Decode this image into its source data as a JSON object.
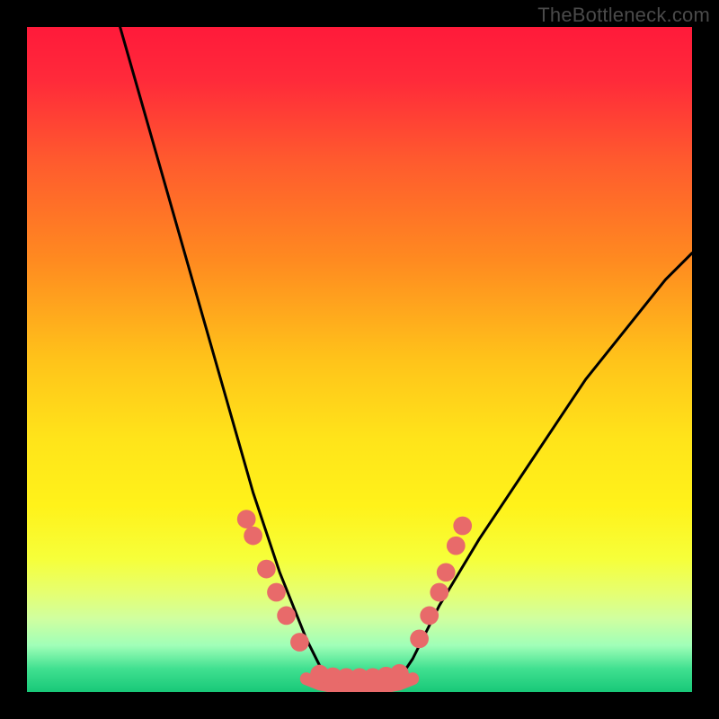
{
  "watermark": "TheBottleneck.com",
  "chart_data": {
    "type": "line",
    "title": "",
    "xlabel": "",
    "ylabel": "",
    "xlim": [
      0,
      100
    ],
    "ylim": [
      0,
      100
    ],
    "grid": false,
    "legend": false,
    "background_gradient_stops": [
      {
        "offset": 0.0,
        "color": "#ff1a3a"
      },
      {
        "offset": 0.08,
        "color": "#ff2a3a"
      },
      {
        "offset": 0.2,
        "color": "#ff5a2e"
      },
      {
        "offset": 0.35,
        "color": "#ff8a20"
      },
      {
        "offset": 0.5,
        "color": "#ffc31a"
      },
      {
        "offset": 0.62,
        "color": "#ffe41a"
      },
      {
        "offset": 0.72,
        "color": "#fff21a"
      },
      {
        "offset": 0.8,
        "color": "#f6ff3a"
      },
      {
        "offset": 0.85,
        "color": "#e6ff70"
      },
      {
        "offset": 0.89,
        "color": "#d0ffa0"
      },
      {
        "offset": 0.93,
        "color": "#a0ffb8"
      },
      {
        "offset": 0.965,
        "color": "#40e090"
      },
      {
        "offset": 1.0,
        "color": "#18c878"
      }
    ],
    "series": [
      {
        "name": "left-curve",
        "stroke": "#000000",
        "x": [
          14,
          16,
          18,
          20,
          22,
          24,
          26,
          28,
          30,
          32,
          34,
          36,
          38,
          40,
          42,
          44,
          45
        ],
        "y": [
          100,
          93,
          86,
          79,
          72,
          65,
          58,
          51,
          44,
          37,
          30,
          24,
          18,
          13,
          8,
          4,
          2
        ]
      },
      {
        "name": "right-curve",
        "stroke": "#000000",
        "x": [
          56,
          58,
          60,
          62,
          65,
          68,
          72,
          76,
          80,
          84,
          88,
          92,
          96,
          100
        ],
        "y": [
          2,
          5,
          9,
          13,
          18,
          23,
          29,
          35,
          41,
          47,
          52,
          57,
          62,
          66
        ]
      },
      {
        "name": "valley-floor",
        "stroke": "#e86a6a",
        "x": [
          42,
          44,
          46,
          48,
          50,
          52,
          54,
          56,
          58
        ],
        "y": [
          2,
          1.2,
          0.8,
          0.7,
          0.7,
          0.7,
          0.8,
          1.2,
          2
        ]
      }
    ],
    "markers": {
      "name": "valley-markers",
      "fill": "#e86a6a",
      "r_frac": 0.014,
      "points": [
        {
          "x": 33.0,
          "y": 26.0
        },
        {
          "x": 34.0,
          "y": 23.5
        },
        {
          "x": 36.0,
          "y": 18.5
        },
        {
          "x": 37.5,
          "y": 15.0
        },
        {
          "x": 39.0,
          "y": 11.5
        },
        {
          "x": 41.0,
          "y": 7.5
        },
        {
          "x": 44.0,
          "y": 2.7
        },
        {
          "x": 46.0,
          "y": 2.3
        },
        {
          "x": 48.0,
          "y": 2.2
        },
        {
          "x": 50.0,
          "y": 2.2
        },
        {
          "x": 52.0,
          "y": 2.2
        },
        {
          "x": 54.0,
          "y": 2.4
        },
        {
          "x": 56.0,
          "y": 2.8
        },
        {
          "x": 59.0,
          "y": 8.0
        },
        {
          "x": 60.5,
          "y": 11.5
        },
        {
          "x": 62.0,
          "y": 15.0
        },
        {
          "x": 63.0,
          "y": 18.0
        },
        {
          "x": 64.5,
          "y": 22.0
        },
        {
          "x": 65.5,
          "y": 25.0
        }
      ]
    }
  }
}
